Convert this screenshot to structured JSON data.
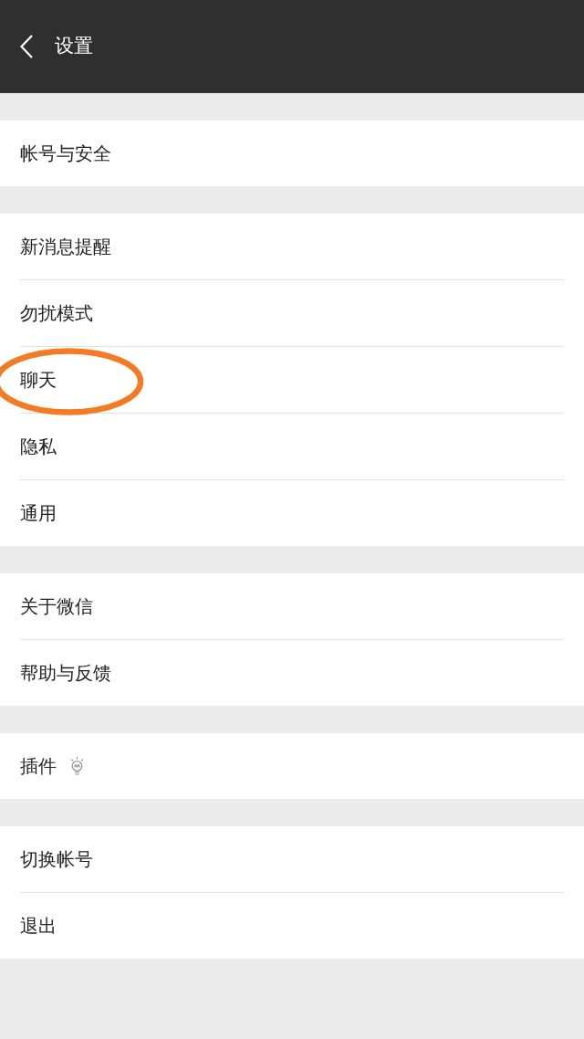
{
  "header": {
    "title": "设置"
  },
  "groups": [
    {
      "items": [
        {
          "label": "帐号与安全",
          "kind": "plain",
          "circled": false
        }
      ]
    },
    {
      "items": [
        {
          "label": "新消息提醒",
          "kind": "plain",
          "circled": false
        },
        {
          "label": "勿扰模式",
          "kind": "plain",
          "circled": false
        },
        {
          "label": "聊天",
          "kind": "plain",
          "circled": true
        },
        {
          "label": "隐私",
          "kind": "plain",
          "circled": false
        },
        {
          "label": "通用",
          "kind": "plain",
          "circled": false
        }
      ]
    },
    {
      "items": [
        {
          "label": "关于微信",
          "kind": "plain",
          "circled": false
        },
        {
          "label": "帮助与反馈",
          "kind": "plain",
          "circled": false
        }
      ]
    },
    {
      "items": [
        {
          "label": "插件",
          "kind": "with_bulb",
          "circled": false
        }
      ]
    },
    {
      "items": [
        {
          "label": "切换帐号",
          "kind": "plain",
          "circled": false
        },
        {
          "label": "退出",
          "kind": "plain",
          "circled": false
        }
      ]
    }
  ]
}
